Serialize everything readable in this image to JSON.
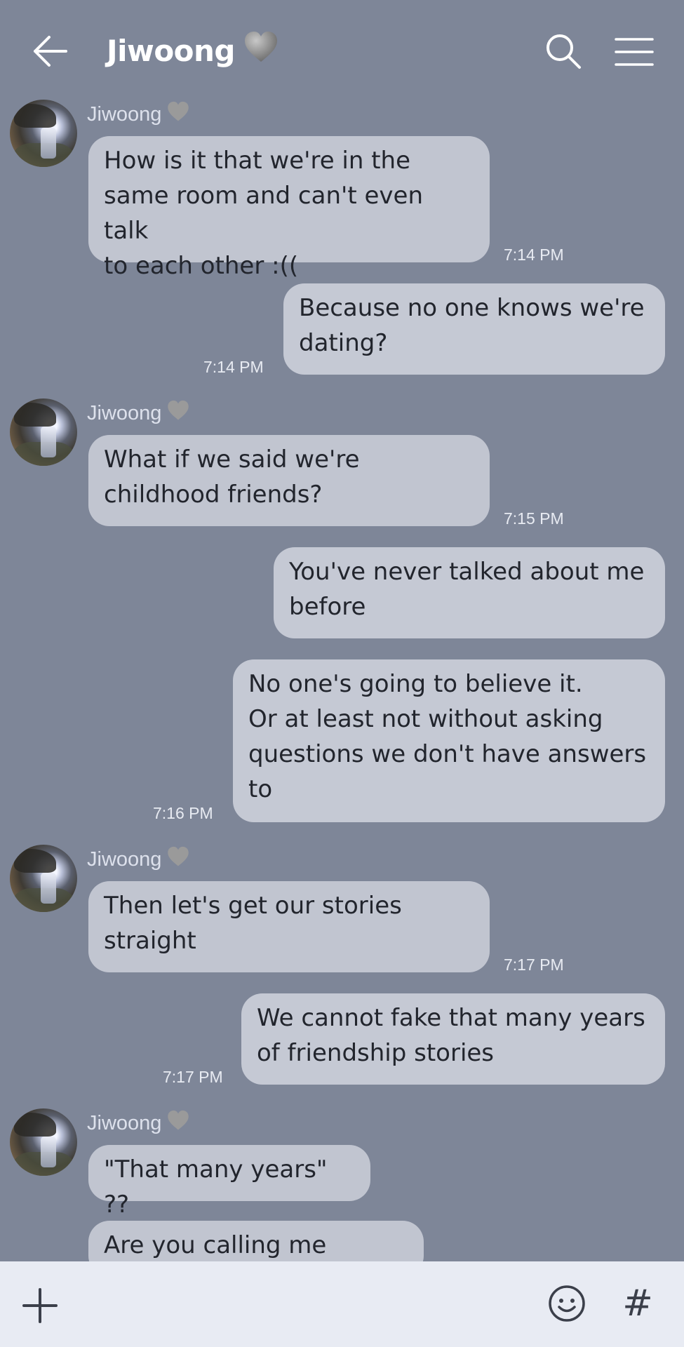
{
  "header": {
    "title": "Jiwoong",
    "title_emoji": "grey-heart-icon",
    "icons": [
      "back-arrow-icon",
      "search-icon",
      "menu-icon"
    ]
  },
  "colors": {
    "background": "#7e8698",
    "bubble": "#c1c5d0",
    "bottom_bar": "#e8ebf3",
    "header_text": "#ffffff"
  },
  "messages": [
    {
      "sender": "Jiwoong",
      "text": "How is it that we're in the\nsame room and can't even talk\nto each other :((",
      "time": "7:14 PM"
    },
    {
      "sender": "me",
      "text": "Because no one knows we're\ndating?",
      "time": "7:14 PM"
    },
    {
      "sender": "Jiwoong",
      "text": "What if we said we're\nchildhood friends?",
      "time": "7:15 PM"
    },
    {
      "sender": "me",
      "text": "You've never talked about me\nbefore",
      "time": ""
    },
    {
      "sender": "me",
      "text": "No one's going to believe it.\nOr at least not without asking\nquestions we don't have answers\nto",
      "time": "7:16 PM"
    },
    {
      "sender": "Jiwoong",
      "text": "Then let's get our stories\nstraight",
      "time": "7:17 PM"
    },
    {
      "sender": "me",
      "text": "We cannot fake that many years\nof friendship stories",
      "time": "7:17 PM"
    },
    {
      "sender": "Jiwoong",
      "text": "\"That many years\" ??",
      "time": ""
    },
    {
      "sender": "Jiwoong",
      "text": "Are you calling me old???",
      "time": ""
    }
  ],
  "bottom_bar": {
    "hash_label": "#",
    "icons": [
      "plus-icon",
      "emoji-icon",
      "hashtag-icon"
    ]
  }
}
